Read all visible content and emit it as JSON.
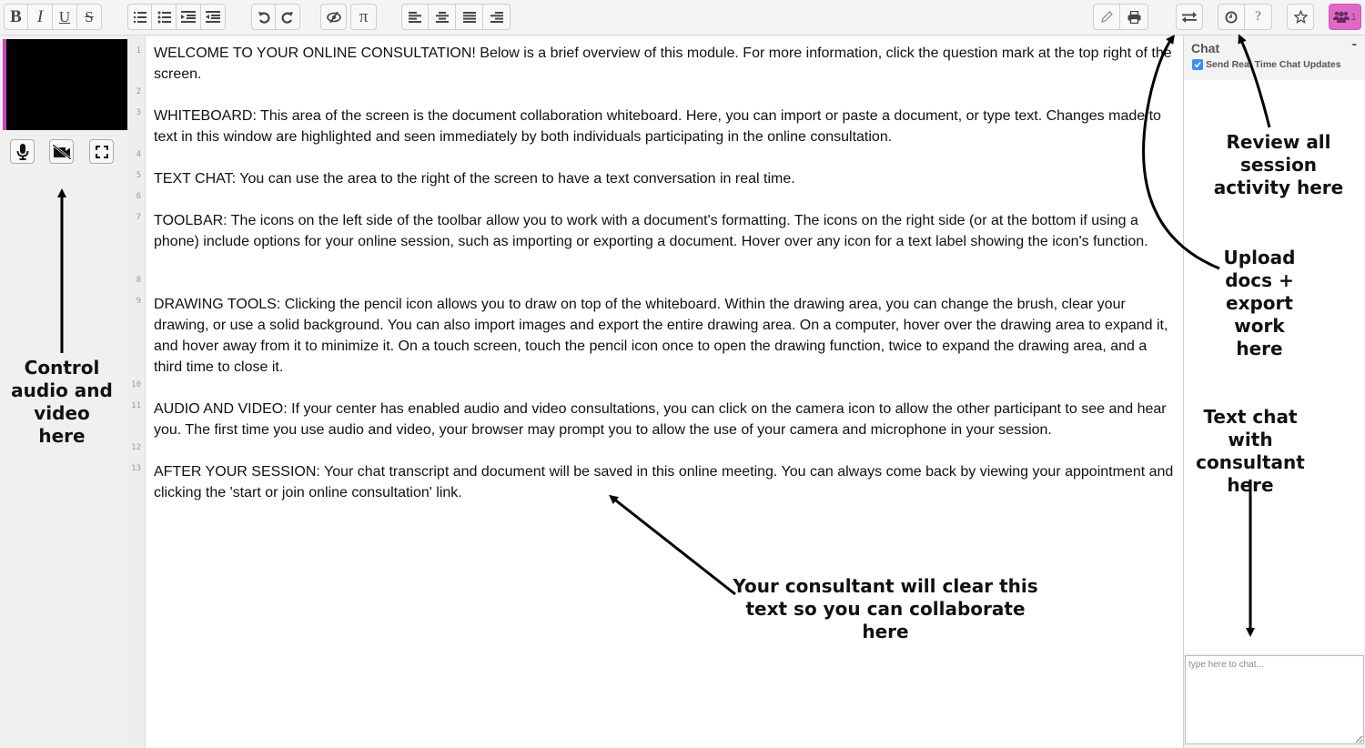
{
  "toolbar": {
    "format": [
      {
        "name": "bold-button",
        "icon": "bold-icon",
        "label": "B"
      },
      {
        "name": "italic-button",
        "icon": "italic-icon",
        "label": "I"
      },
      {
        "name": "underline-button",
        "icon": "underline-icon",
        "label": "U"
      },
      {
        "name": "strikethrough-button",
        "icon": "strikethrough-icon",
        "label": "S"
      }
    ],
    "lists": [
      "ordered-list-icon",
      "unordered-list-icon",
      "indent-icon",
      "outdent-icon"
    ],
    "history": [
      "undo-icon",
      "redo-icon"
    ],
    "misc": [
      "hide-highlight-icon",
      "pi-icon"
    ],
    "pi_label": "π",
    "align": [
      "align-left-icon",
      "align-center-icon",
      "align-justify-icon",
      "align-right-icon"
    ],
    "right": [
      "pencil-icon",
      "print-icon",
      "import-export-icon",
      "history-icon",
      "help-icon",
      "star-icon",
      "users-icon"
    ],
    "help_label": "?",
    "users_count": "1",
    "users_color": "#e069c8"
  },
  "left_panel": {
    "video_accent": "#c847b8",
    "controls": [
      "microphone-icon",
      "camera-off-icon",
      "fullscreen-icon"
    ]
  },
  "editor": {
    "line_numbers": [
      "1",
      "2",
      "3",
      "4",
      "5",
      "6",
      "7",
      "8",
      "9",
      "10",
      "11",
      "12",
      "13"
    ],
    "paragraphs": [
      "WELCOME TO YOUR ONLINE CONSULTATION! Below is a brief overview of this module. For more information, click the question mark at the top right of the screen.",
      "WHITEBOARD: This area of the screen is the document collaboration whiteboard. Here, you can import or paste a document, or type text. Changes made to text in this window are highlighted and seen immediately by both individuals participating in the online consultation.",
      "TEXT CHAT: You can use the area to the right of the screen to have a text conversation in real time.",
      "TOOLBAR: The icons on the left side of the toolbar allow you to work with a document's formatting. The icons on the right side (or at the bottom if using a phone) include options for your online session, such as importing or exporting a document. Hover over any icon for a text label showing the icon's function.",
      "DRAWING TOOLS: Clicking the pencil icon allows you to draw on top of the whiteboard. Within the drawing area, you can change the brush, clear your drawing, or use a solid background. You can also import images and export the entire drawing area. On a computer, hover over the drawing area to expand it, and hover away from it to minimize it. On a touch screen, touch the pencil icon once to open the drawing function, twice to expand the drawing area, and a third time to close it.",
      "AUDIO AND VIDEO: If your center has enabled audio and video consultations, you can click on the camera icon to allow the other participant to see and hear you. The first time you use audio and video, your browser may prompt you to allow the use of your camera and microphone in your session.",
      "AFTER YOUR SESSION: Your chat transcript and document will be saved in this online meeting. You can always come back by viewing your appointment and clicking the 'start or join online consultation' link."
    ]
  },
  "chat": {
    "title": "Chat",
    "minimize_label": "-",
    "realtime_label": "Send Real Time Chat Updates",
    "realtime_checked": true,
    "input_placeholder": "type here to chat...",
    "input_value": "",
    "checkbox_color": "#3b8ff0"
  },
  "annotations": {
    "av": "Control audio and video here",
    "review": "Review all session activity here",
    "upload": "Upload docs + export work here",
    "chat": "Text chat with consultant here",
    "clear": "Your consultant will clear this text so you can collaborate here"
  }
}
